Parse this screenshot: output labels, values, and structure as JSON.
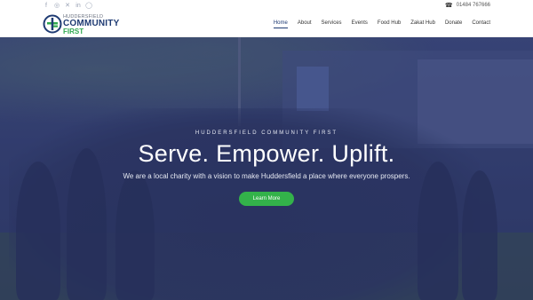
{
  "topbar": {
    "social_icons": [
      "facebook-icon",
      "instagram-icon",
      "x-icon",
      "linkedin-icon",
      "whatsapp-icon"
    ],
    "phone": "01484 767666"
  },
  "logo": {
    "small": "HUDDERSFIELD",
    "big": "COMMUNITY",
    "first": "FIRST"
  },
  "nav": {
    "items": [
      "Home",
      "About",
      "Services",
      "Events",
      "Food Hub",
      "Zakat Hub",
      "Donate",
      "Contact"
    ],
    "active": "Home"
  },
  "hero": {
    "eyebrow": "HUDDERSFIELD COMMUNITY FIRST",
    "headline": "Serve. Empower. Uplift.",
    "subtitle": "We are a local charity with a vision to make Huddersfield a place where everyone prospers.",
    "cta": "Learn More"
  },
  "colors": {
    "brand_navy": "#1f3b73",
    "brand_green": "#2fa84f",
    "cta_green": "#33b24a",
    "hero_overlay": "#28326a"
  }
}
